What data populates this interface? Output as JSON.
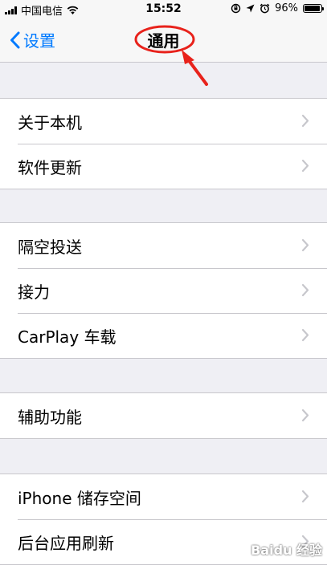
{
  "status_bar": {
    "carrier": "中国电信",
    "time": "15:52",
    "battery": "96%",
    "battery_level": 0.96
  },
  "nav": {
    "back_label": "设置",
    "title": "通用",
    "accent_color": "#007aff",
    "annotation_color": "#e8221b"
  },
  "groups": [
    {
      "items": [
        "关于本机",
        "软件更新"
      ]
    },
    {
      "items": [
        "隔空投送",
        "接力",
        "CarPlay 车载"
      ]
    },
    {
      "items": [
        "辅助功能"
      ]
    },
    {
      "items": [
        "iPhone 储存空间",
        "后台应用刷新"
      ]
    }
  ],
  "watermark": "Baidu 经验",
  "icons": [
    "signal-icon",
    "wifi-icon",
    "orientation-lock-icon",
    "location-icon",
    "alarm-icon",
    "battery-icon",
    "chevron-left-icon",
    "chevron-right-icon"
  ]
}
